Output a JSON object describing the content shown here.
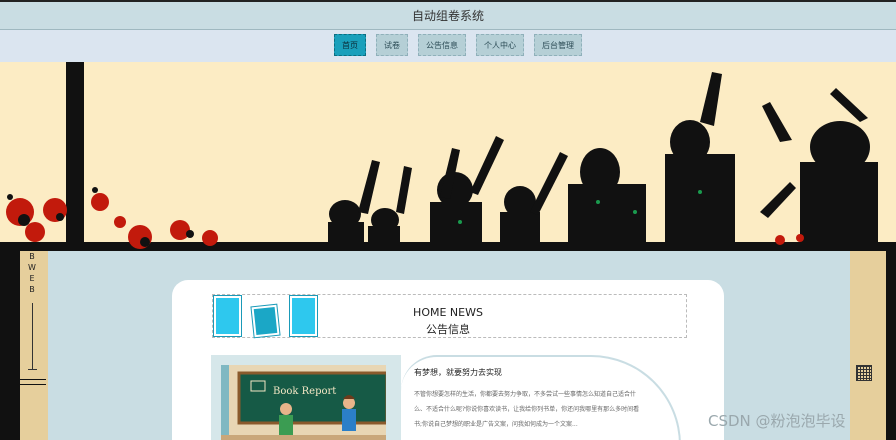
{
  "header": {
    "title": "自动组卷系统"
  },
  "nav": {
    "items": [
      {
        "label": "首页",
        "active": true
      },
      {
        "label": "试卷",
        "active": false
      },
      {
        "label": "公告信息",
        "active": false
      },
      {
        "label": "个人中心",
        "active": false
      },
      {
        "label": "后台管理",
        "active": false
      }
    ]
  },
  "side": {
    "vertical_text": "B W E B"
  },
  "news": {
    "heading_en": "HOME NEWS",
    "heading_cn": "公告信息",
    "item": {
      "title": "有梦想，就要努力去实现",
      "body": "不管你想要怎样的生活，你都要去努力争取，不多尝试一些事情怎么知道自己适合什么、不适合什么呢?你说你喜欢读书，让我给你列书单，你还问我哪里有那么多时间看书;你说自己梦想的职业是广告文案，问我如何成为一个文案...",
      "image_caption": "Book Report"
    }
  },
  "watermark": "CSDN @粉泡泡毕设",
  "colors": {
    "accent": "#1aa0bb",
    "header_bg": "#c9dde3",
    "nav_bg": "#dbe5f0",
    "banner_bg": "#fcecc4",
    "side_bg": "#e6cf9c"
  }
}
